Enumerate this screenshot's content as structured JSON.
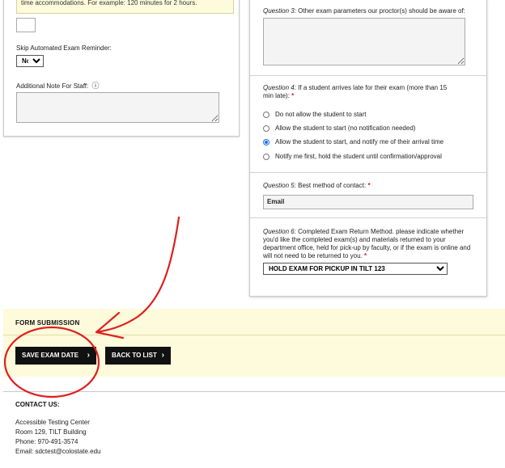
{
  "left_form": {
    "note_text": "time accommodations. For example: 120 minutes for 2 hours.",
    "skip_reminder_label": "Skip Automated Exam Reminder:",
    "skip_reminder_value": "No",
    "additional_note_label": "Additional Note For Staff:",
    "help_icon_glyph": "ⓘ"
  },
  "right_form": {
    "q3_prefix": "Question 3:",
    "q3_text": " Other exam parameters our proctor(s) should be aware of:",
    "q4_prefix": "Question 4:",
    "q4_text": " If a student arrives late for their exam (more than 15 min late):",
    "q4_options": [
      "Do not allow the student to start",
      "Allow the student to start (no notification needed)",
      "Allow the student to start, and notify me of their arrival time",
      "Notify me first, hold the student until confirmation/approval"
    ],
    "q4_selected_index": 2,
    "q5_prefix": "Question 5:",
    "q5_text": " Best method of contact:",
    "q5_value": "Email",
    "q6_prefix": "Question 6:",
    "q6_text": " Completed Exam Return Method. please indicate whether you'd like the completed exam(s) and materials returned to your department office, held for pick-up by faculty, or if the exam is online and will not need to be returned to you.",
    "q6_value": "HOLD EXAM FOR PICKUP IN TILT 123",
    "required_mark": "*"
  },
  "submission": {
    "title": "FORM SUBMISSION",
    "save_label": "SAVE EXAM DATE",
    "back_label": "BACK TO LIST",
    "chevron_glyph": "›"
  },
  "contact": {
    "title": "CONTACT US:",
    "lines": [
      "Accessible Testing Center",
      "Room 129, TILT Building",
      "Phone: 970-491-3574",
      "Email: sdctest@colostate.edu"
    ]
  },
  "colors": {
    "accent_red": "#d62020",
    "submission_bg": "#fdfbdc",
    "button_bg": "#111111"
  }
}
